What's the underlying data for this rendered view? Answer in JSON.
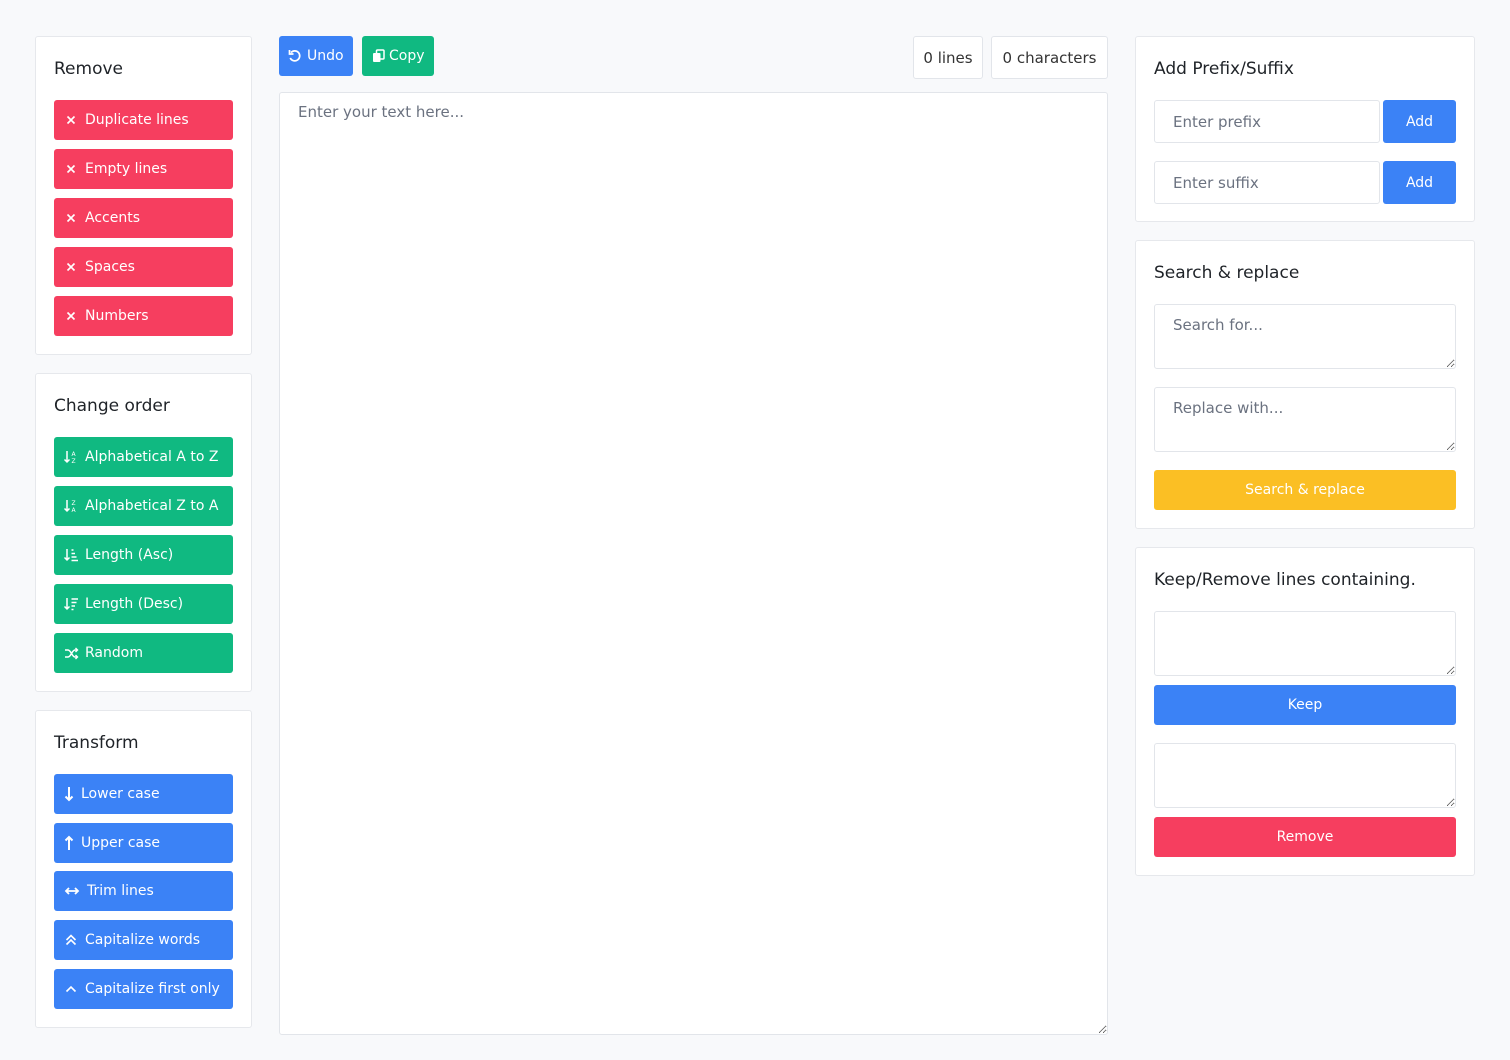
{
  "toolbar": {
    "undo_label": "Undo",
    "copy_label": "Copy",
    "lines_count": "0 lines",
    "characters_count": "0 characters"
  },
  "editor": {
    "placeholder": "Enter your text here..."
  },
  "remove_panel": {
    "title": "Remove",
    "items": [
      {
        "label": "Duplicate lines",
        "icon": "x-icon"
      },
      {
        "label": "Empty lines",
        "icon": "x-icon"
      },
      {
        "label": "Accents",
        "icon": "x-icon"
      },
      {
        "label": "Spaces",
        "icon": "x-icon"
      },
      {
        "label": "Numbers",
        "icon": "x-icon"
      }
    ]
  },
  "order_panel": {
    "title": "Change order",
    "items": [
      {
        "label": "Alphabetical A to Z",
        "icon": "sort-alpha-asc-icon"
      },
      {
        "label": "Alphabetical Z to A",
        "icon": "sort-alpha-desc-icon"
      },
      {
        "label": "Length (Asc)",
        "icon": "sort-length-asc-icon"
      },
      {
        "label": "Length (Desc)",
        "icon": "sort-length-desc-icon"
      },
      {
        "label": "Random",
        "icon": "shuffle-icon"
      }
    ]
  },
  "transform_panel": {
    "title": "Transform",
    "items": [
      {
        "label": "Lower case",
        "icon": "arrow-down-icon"
      },
      {
        "label": "Upper case",
        "icon": "arrow-up-icon"
      },
      {
        "label": "Trim lines",
        "icon": "arrows-horizontal-icon"
      },
      {
        "label": "Capitalize words",
        "icon": "double-chevron-up-icon"
      },
      {
        "label": "Capitalize first only",
        "icon": "chevron-up-icon"
      }
    ]
  },
  "prefix_panel": {
    "title": "Add Prefix/Suffix",
    "prefix_placeholder": "Enter prefix",
    "suffix_placeholder": "Enter suffix",
    "add_label": "Add"
  },
  "search_panel": {
    "title": "Search & replace",
    "search_placeholder": "Search for...",
    "replace_placeholder": "Replace with...",
    "button_label": "Search & replace"
  },
  "filter_panel": {
    "title": "Keep/Remove lines containing.",
    "keep_label": "Keep",
    "remove_label": "Remove"
  },
  "colors": {
    "red": "#f63e5f",
    "green": "#10b981",
    "blue": "#3b82f6",
    "yellow": "#fbbf24"
  }
}
